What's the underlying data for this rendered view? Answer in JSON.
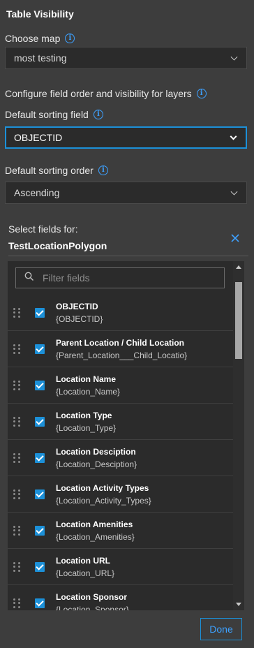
{
  "panel": {
    "title": "Table Visibility"
  },
  "choose_map": {
    "label": "Choose map",
    "value": "most testing"
  },
  "configure": {
    "label": "Configure field order and visibility for layers"
  },
  "sort_field": {
    "label": "Default sorting field",
    "value": "OBJECTID"
  },
  "sort_order": {
    "label": "Default sorting order",
    "value": "Ascending"
  },
  "fields_section": {
    "label": "Select fields for:",
    "layer": "TestLocationPolygon",
    "filter_placeholder": "Filter fields",
    "items": [
      {
        "alias": "OBJECTID",
        "name": "{OBJECTID}",
        "checked": true
      },
      {
        "alias": "Parent Location / Child Location",
        "name": "{Parent_Location___Child_Locatio}",
        "checked": true
      },
      {
        "alias": "Location Name",
        "name": "{Location_Name}",
        "checked": true
      },
      {
        "alias": "Location Type",
        "name": "{Location_Type}",
        "checked": true
      },
      {
        "alias": "Location Desciption",
        "name": "{Location_Desciption}",
        "checked": true
      },
      {
        "alias": "Location Activity Types",
        "name": "{Location_Activity_Types}",
        "checked": true
      },
      {
        "alias": "Location Amenities",
        "name": "{Location_Amenities}",
        "checked": true
      },
      {
        "alias": "Location URL",
        "name": "{Location_URL}",
        "checked": true
      },
      {
        "alias": "Location Sponsor",
        "name": "{Location_Sponsor}",
        "checked": true
      }
    ]
  },
  "footer": {
    "done_label": "Done"
  },
  "colors": {
    "accent": "#1c90d8",
    "background": "#3d3d3d",
    "surface": "#2b2b2b"
  },
  "icons": {
    "info": "info-circle-icon",
    "close": "close-icon",
    "search": "search-icon",
    "drag": "drag-handle-icon",
    "chevron": "chevron-down-icon"
  }
}
